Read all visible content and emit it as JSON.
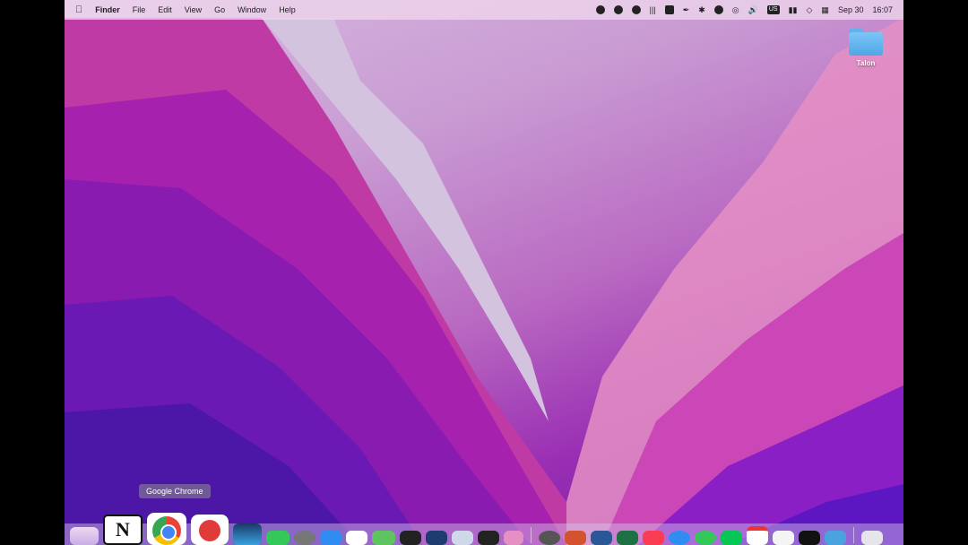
{
  "menubar": {
    "apple": "",
    "app_name": "Finder",
    "menus": [
      "File",
      "Edit",
      "View",
      "Go",
      "Window",
      "Help"
    ],
    "input_source": "US",
    "date": "Sep 30",
    "time": "16:07"
  },
  "desktop": {
    "folder_label": "Talon"
  },
  "dock": {
    "tooltip": "Google Chrome",
    "apps": [
      "launchpad",
      "notion",
      "google-chrome",
      "app-red",
      "app-blue",
      "app-green",
      "app-gray",
      "app-a",
      "app-slack",
      "app-calendar",
      "app-figure",
      "app-b",
      "app-doc",
      "app-audio",
      "app-c",
      "app-d",
      "app-e",
      "app-f",
      "app-g",
      "app-h",
      "app-i",
      "app-j",
      "app-k",
      "app-calendar2",
      "app-l",
      "app-terminal",
      "app-m",
      "trash"
    ]
  }
}
